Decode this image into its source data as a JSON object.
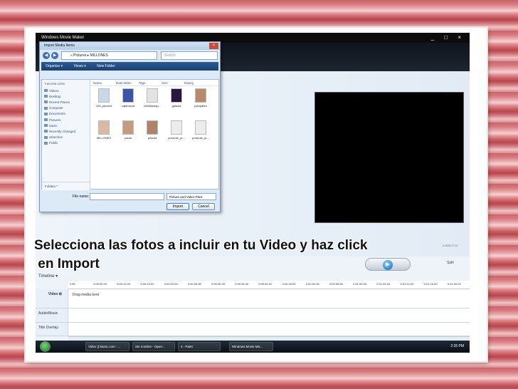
{
  "wmm": {
    "title": "Windows Movie Maker",
    "window_controls": "_ □ ×",
    "preview_time": "0:00/0:27:11",
    "split_label": "Split",
    "timeline": {
      "toolbar_label": "Timeline ▾",
      "ticks": [
        "0.00",
        "0:00:05.00",
        "0:00:10.00",
        "0:00:15.00",
        "0:00:20.00",
        "0:00:25.00",
        "0:00:30.00",
        "0:00:35.00",
        "0:00:40.00",
        "0:00:45.00",
        "0:00:50.00",
        "0:00:55.00",
        "0:01:00.00",
        "0:01:05.00",
        "0:01:10.00",
        "0:01:15.00",
        "0:01:20.00"
      ],
      "video_label": "Video ⊞",
      "drag_text": "Drag media here",
      "audio_label": "Audio/Music",
      "title_label": "Title Overlay"
    }
  },
  "dialog": {
    "title": "Import Media Items",
    "close": "×",
    "back": "◀",
    "forward": "▶",
    "address": "« Pictures ▸ MILLONES",
    "search_placeholder": "Search",
    "toolbar": {
      "organize": "Organize ▾",
      "views": "Views ▾",
      "new_folder": "New Folder"
    },
    "favorites_heading": "Favorite Links",
    "favorites": [
      "Videos",
      "Desktop",
      "Recent Places",
      "Computer",
      "Documents",
      "Pictures",
      "Music",
      "Recently Changed",
      "Searches",
      "Public"
    ],
    "folders_label": "Folders ^",
    "columns": [
      "Name",
      "Date taken",
      "Tags",
      "Size",
      "Rating"
    ],
    "files": [
      {
        "name": "100_percent",
        "color": "#c8d7ea"
      },
      {
        "name": "cajanueva",
        "color": "#3a55a8"
      },
      {
        "name": "clickbanksp...",
        "color": "#e3e3e3"
      },
      {
        "name": "galaxia",
        "color": "#2a1740"
      },
      {
        "name": "juanpablo",
        "color": "#b88a6a"
      },
      {
        "name": "MILLONES",
        "color": "#d7b9a4"
      },
      {
        "name": "paola",
        "color": "#c59b80"
      },
      {
        "name": "priscila",
        "color": "#b0826a"
      },
      {
        "name": "promote_pr...",
        "color": "#ececec"
      },
      {
        "name": "promote_pr...",
        "color": "#ececec"
      }
    ],
    "file_name_label": "File name:",
    "file_name_value": "",
    "file_type": "Picture and Video Files",
    "import_button": "Import",
    "cancel_button": "Cancel"
  },
  "taskbar": {
    "buttons": [
      "Video || Music.com - ...",
      "Sin nombre - Open...",
      "4 - Paint",
      "Windows Movie Ma..."
    ],
    "clock": "2:35 PM"
  },
  "caption": {
    "line1": "Selecciona las fotos a incluir en tu Video y haz click",
    "line2": " en Import"
  }
}
